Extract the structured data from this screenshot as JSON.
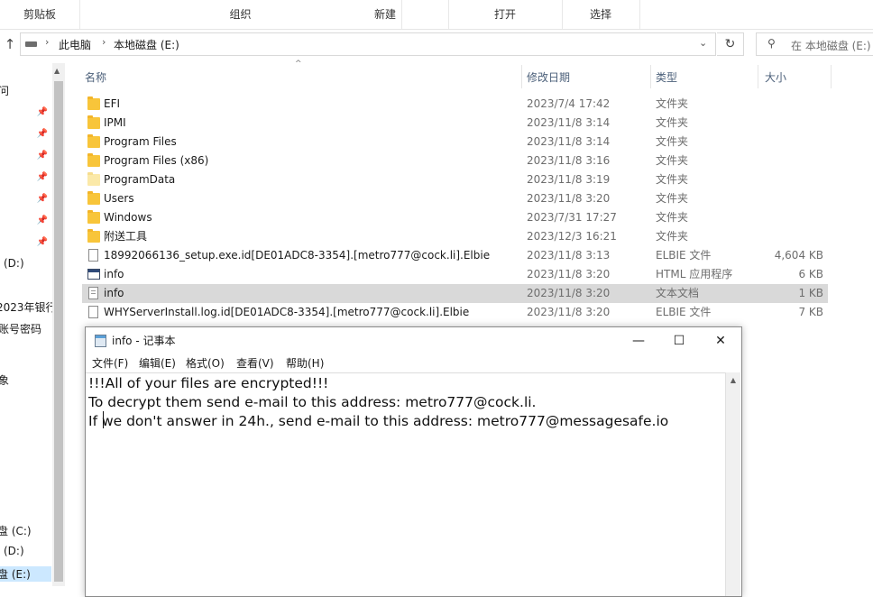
{
  "ribbon": {
    "groups": [
      "剪贴板",
      "组织",
      "新建",
      "打开",
      "选择"
    ]
  },
  "address": {
    "path": [
      "此电脑",
      "本地磁盘 (E:)"
    ],
    "search_placeholder": "在 本地磁盘 (E:)"
  },
  "nav": {
    "items": [
      "问",
      "(D:)",
      "2023年银行",
      "账号密码",
      "象",
      "盘 (C:)",
      "(D:)",
      "盘 (E:)"
    ]
  },
  "columns": {
    "name": "名称",
    "date": "修改日期",
    "type": "类型",
    "size": "大小"
  },
  "files": [
    {
      "name": "EFI",
      "date": "2023/7/4 17:42",
      "type": "文件夹",
      "size": "",
      "icon": "folder-icon"
    },
    {
      "name": "IPMI",
      "date": "2023/11/8 3:14",
      "type": "文件夹",
      "size": "",
      "icon": "folder-icon"
    },
    {
      "name": "Program Files",
      "date": "2023/11/8 3:14",
      "type": "文件夹",
      "size": "",
      "icon": "folder-icon"
    },
    {
      "name": "Program Files (x86)",
      "date": "2023/11/8 3:16",
      "type": "文件夹",
      "size": "",
      "icon": "folder-icon"
    },
    {
      "name": "ProgramData",
      "date": "2023/11/8 3:19",
      "type": "文件夹",
      "size": "",
      "icon": "folder-icon"
    },
    {
      "name": "Users",
      "date": "2023/11/8 3:20",
      "type": "文件夹",
      "size": "",
      "icon": "folder-icon"
    },
    {
      "name": "Windows",
      "date": "2023/7/31 17:27",
      "type": "文件夹",
      "size": "",
      "icon": "folder-icon"
    },
    {
      "name": "附送工具",
      "date": "2023/12/3 16:21",
      "type": "文件夹",
      "size": "",
      "icon": "folder-icon"
    },
    {
      "name": "18992066136_setup.exe.id[DE01ADC8-3354].[metro777@cock.li].Elbie",
      "date": "2023/11/8 3:13",
      "type": "ELBIE 文件",
      "size": "4,604 KB",
      "icon": "file-icon"
    },
    {
      "name": "info",
      "date": "2023/11/8 3:20",
      "type": "HTML 应用程序",
      "size": "6 KB",
      "icon": "hta-icon"
    },
    {
      "name": "info",
      "date": "2023/11/8 3:20",
      "type": "文本文档",
      "size": "1 KB",
      "icon": "text-file-icon"
    },
    {
      "name": "WHYServerInstall.log.id[DE01ADC8-3354].[metro777@cock.li].Elbie",
      "date": "2023/11/8 3:20",
      "type": "ELBIE 文件",
      "size": "7 KB",
      "icon": "file-icon"
    }
  ],
  "notepad": {
    "title": "info - 记事本",
    "menu": [
      "文件(F)",
      "编辑(E)",
      "格式(O)",
      "查看(V)",
      "帮助(H)"
    ],
    "lines": [
      "!!!All of your files are encrypted!!!",
      "To decrypt them send e-mail to this address: metro777@cock.li.",
      "If we don't answer in 24h., send e-mail to this address: metro777@messagesafe.io"
    ],
    "buttons": {
      "minimize": "—",
      "maximize": "☐",
      "close": "✕"
    }
  }
}
